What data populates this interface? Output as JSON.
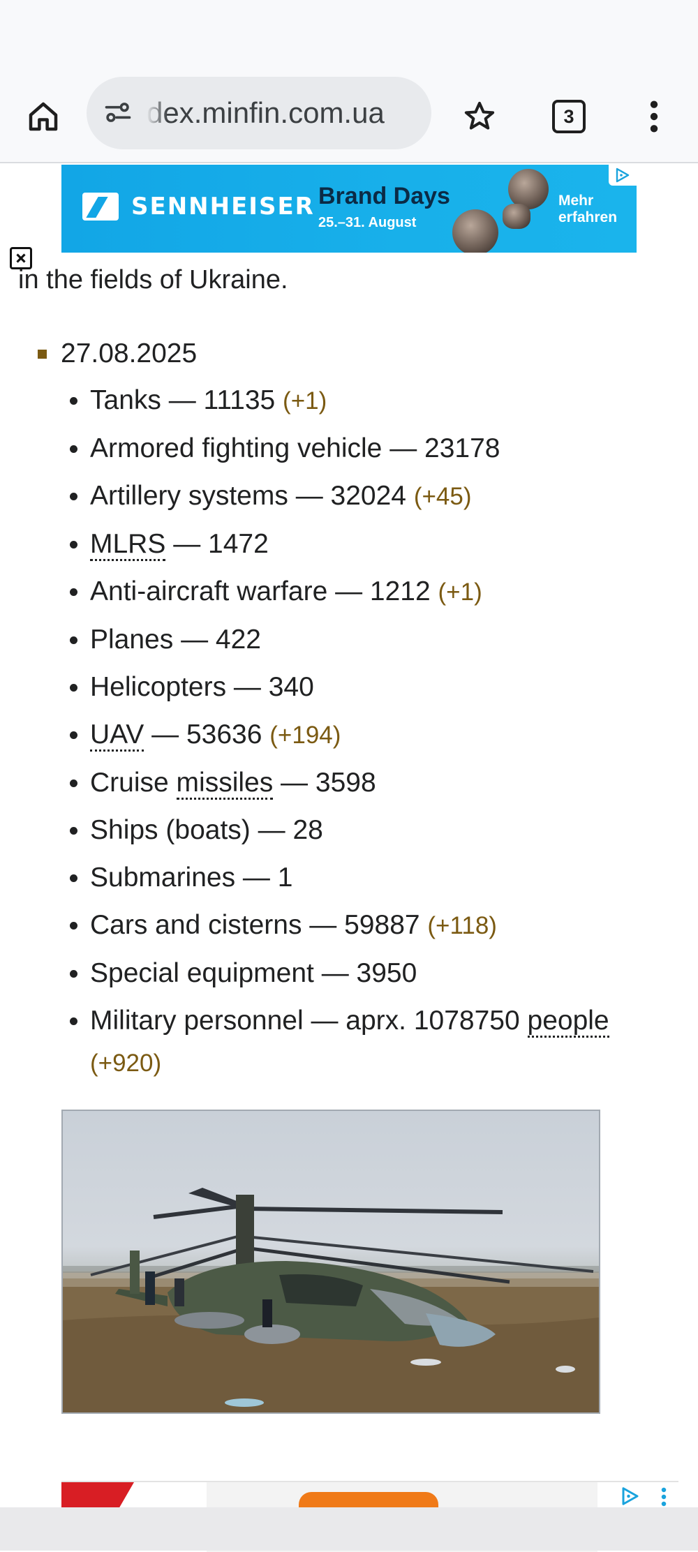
{
  "browser": {
    "url": "dex.minfin.com.ua",
    "tab_count": "3",
    "icons": [
      "home-icon",
      "site-info-icon",
      "star-icon",
      "tab-switcher-icon",
      "more-vert-icon"
    ]
  },
  "ad_top": {
    "brand": "SENNHEISER",
    "title": "Brand Days",
    "dates": "25.–31. August",
    "cta_line1": "Mehr",
    "cta_line2": "erfahren",
    "close_icon": "close-icon",
    "adchoices_icon": "adchoices-icon"
  },
  "article": {
    "partial_text": "in the fields of Ukraine.",
    "date": "27.08.2025",
    "items": [
      {
        "pre": "Tanks — 11135 ",
        "delta": "(+1)"
      },
      {
        "pre": "Armored fighting vehicle — 23178",
        "delta": ""
      },
      {
        "pre": "Artillery systems — 32024 ",
        "delta": "(+45)"
      },
      {
        "link": "MLRS",
        "post": " — 1472"
      },
      {
        "pre": "Anti-aircraft warfare — 1212 ",
        "delta": "(+1)"
      },
      {
        "pre": "Planes — 422"
      },
      {
        "pre": "Helicopters — 340"
      },
      {
        "link": "UAV",
        "post": " — 53636 ",
        "delta": "(+194)"
      },
      {
        "pre": "Cruise ",
        "link": "missiles",
        "post": " — 3598"
      },
      {
        "pre": "Ships (boats) — 28"
      },
      {
        "pre": "Submarines — 1"
      },
      {
        "pre": "Cars and cisterns — 59887 ",
        "delta": "(+118)"
      },
      {
        "pre": "Special equipment — 3950"
      },
      {
        "pre": "Military personnel — aprx. 1078750 ",
        "link": "people",
        "delta": "(+920)"
      }
    ]
  },
  "colors": {
    "delta": "#7b5a12",
    "ad_blue": "#12a6e6"
  }
}
